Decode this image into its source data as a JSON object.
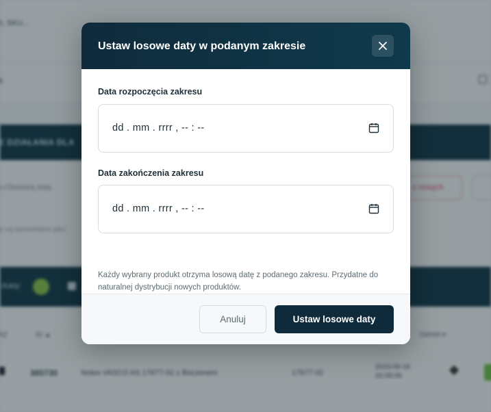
{
  "background": {
    "sku_text": "D, SKU...",
    "filter_text": "e",
    "section_title": "E DZIAŁANIA DLA",
    "placeholder_text": "o-Olosową datę",
    "reset_button": "z nowych",
    "note_text": "ty są wyświetlane jako",
    "counter_label": "dukty:",
    "col_az": "AZ",
    "col_id": "ID ▲",
    "col_data": "DANIA ▾",
    "row_id": "385730",
    "row_name": "Notes VASCO AS 17677-02 z Boczenem",
    "row_code": "17677-02",
    "row_date_line1": "2023-05-16",
    "row_date_line2": "02:05:06"
  },
  "modal": {
    "title": "Ustaw losowe daty w podanym zakresie",
    "start_label": "Data rozpoczęcia zakresu",
    "start_value": "dd . mm . rrrr ,  -- : --",
    "end_label": "Data zakończenia zakresu",
    "end_value": "dd . mm . rrrr ,  -- : --",
    "hint": "Każdy wybrany produkt otrzyma losową datę z podanego zakresu. Przydatne do naturalnej dystrybucji nowych produktów.",
    "cancel_label": "Anuluj",
    "confirm_label": "Ustaw losowe daty"
  },
  "colors": {
    "header_bg": "#0f2b3b",
    "primary_button": "#0f2b3b",
    "overlay": "rgba(18,36,44,0.42)"
  },
  "icons": {
    "close": "close-icon",
    "calendar": "calendar-icon"
  }
}
